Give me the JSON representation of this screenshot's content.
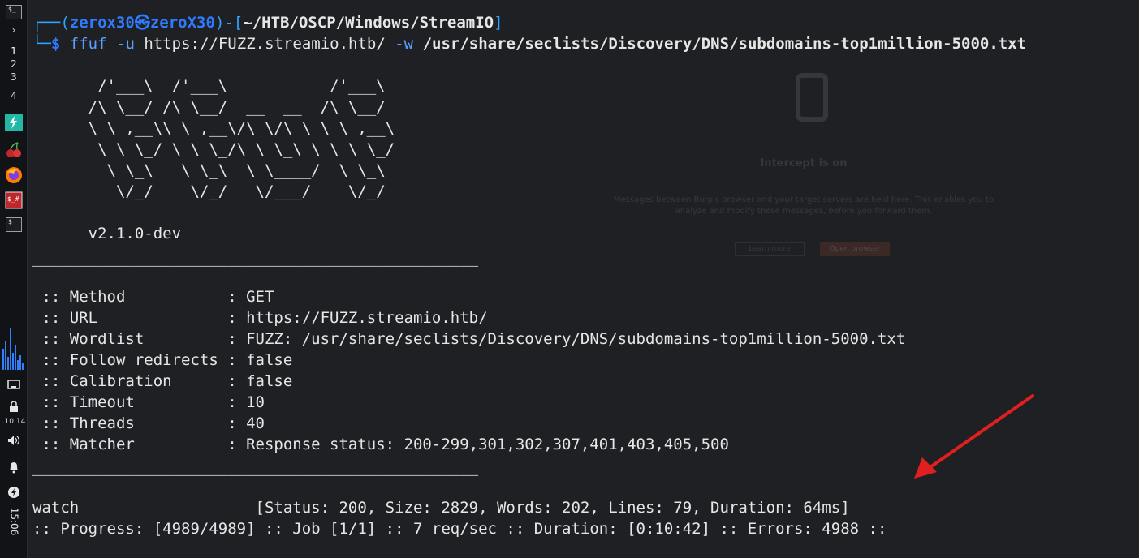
{
  "taskbar": {
    "workspaces": [
      "1",
      "2",
      "3",
      "4"
    ],
    "ip_text": ".10.14",
    "clock": "15:06",
    "colors": {
      "accent_green": "#23b7a6",
      "graph_blue": "#2f80ff",
      "firefox": "#ff7a00",
      "red_app": "#c0272d"
    }
  },
  "terminal": {
    "prompt": {
      "open": "┌──(",
      "user": "zerox30",
      "at_icon": "㉿",
      "host": "zeroX30",
      "mid": ")-[",
      "path": "~/HTB/OSCP/Windows/StreamIO",
      "close": "]",
      "line2_prefix": "└─",
      "dollar": "$",
      "cmd": "ffuf",
      "flag_u": "-u",
      "url": "https://FUZZ.streamio.htb/",
      "flag_w": "-w",
      "wordlist": "/usr/share/seclists/Discovery/DNS/subdomains-top1million-5000.txt"
    },
    "banner": [
      "       /'___\\  /'___\\           /'___\\",
      "      /\\ \\__/ /\\ \\__/  __  __  /\\ \\__/",
      "      \\ \\ ,__\\\\ \\ ,__\\/\\ \\/\\ \\ \\ \\ ,__\\",
      "       \\ \\ \\_/ \\ \\ \\_/\\ \\ \\_\\ \\ \\ \\ \\_/",
      "        \\ \\_\\   \\ \\_\\  \\ \\____/  \\ \\_\\",
      "         \\/_/    \\/_/   \\/___/    \\/_/"
    ],
    "version": "      v2.1.0-dev",
    "separator": "________________________________________________",
    "settings": [
      " :: Method           : GET",
      " :: URL              : https://FUZZ.streamio.htb/",
      " :: Wordlist         : FUZZ: /usr/share/seclists/Discovery/DNS/subdomains-top1million-5000.txt",
      " :: Follow redirects : false",
      " :: Calibration      : false",
      " :: Timeout          : 10",
      " :: Threads          : 40",
      " :: Matcher          : Response status: 200-299,301,302,307,401,403,405,500"
    ],
    "result": "watch                   [Status: 200, Size: 2829, Words: 202, Lines: 79, Duration: 64ms]",
    "progress": ":: Progress: [4989/4989] :: Job [1/1] :: 7 req/sec :: Duration: [0:10:42] :: Errors: 4988 ::"
  },
  "overlay": {
    "title": "Intercept is on",
    "text_line1": "Messages between Burp's browser and your target servers are held here. This enables you to",
    "text_line2": "analyze and modify these messages, before you forward them.",
    "btn_learn": "Learn more",
    "btn_open": "Open browser"
  },
  "annotation_color": "#e0201e"
}
